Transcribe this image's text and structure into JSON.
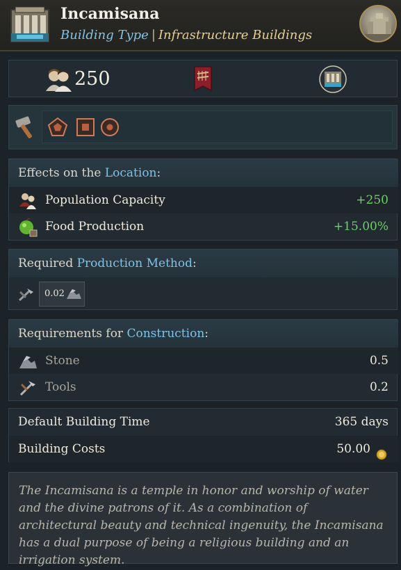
{
  "header": {
    "title": "Incamisana",
    "building_type_label": "Building Type",
    "separator": "|",
    "category": "Infrastructure Buildings",
    "icon": "aqueduct-building-icon",
    "portrait": "building-portrait-icon"
  },
  "stats": {
    "population": "250",
    "pop_icon": "population-icon",
    "banner_icon": "banner-icon",
    "building_icon": "building-icon"
  },
  "tools": {
    "hammer_icon": "hammer-icon",
    "shapes": [
      "pentagon-icon",
      "square-icon",
      "circle-icon"
    ]
  },
  "effects": {
    "heading_prefix": "Effects on the",
    "heading_keyword": "Location",
    "heading_suffix": ":",
    "rows": [
      {
        "label": "Population Capacity",
        "value": "+250",
        "icon": "population-capacity-icon"
      },
      {
        "label": "Food Production",
        "value": "+15.00%",
        "icon": "food-apple-icon"
      }
    ]
  },
  "production": {
    "heading_prefix": "Required",
    "heading_keyword": "Production Method",
    "heading_suffix": ":",
    "input_icon": "tools-icon",
    "amount": "0.02",
    "output_icon": "stone-icon"
  },
  "construction": {
    "heading_prefix": "Requirements for",
    "heading_keyword": "Construction",
    "heading_suffix": ":",
    "rows": [
      {
        "label": "Stone",
        "value": "0.5",
        "icon": "stone-icon"
      },
      {
        "label": "Tools",
        "value": "0.2",
        "icon": "tools-icon"
      }
    ]
  },
  "timing": {
    "time_label": "Default Building Time",
    "time_value": "365 days",
    "cost_label": "Building Costs",
    "cost_value": "50.00",
    "coin_icon": "gold-coin-icon"
  },
  "description": "The Incamisana is a temple in honor and worship of water and the divine patrons of it. As a combination of architectural beauty and technical ingenuity, the Incamisana has a dual purpose of being a religious building and an irrigation system.",
  "colors": {
    "accent_blue": "#7fc4e8",
    "accent_gold": "#e9cf8d",
    "positive_green": "#6fcf6a"
  }
}
